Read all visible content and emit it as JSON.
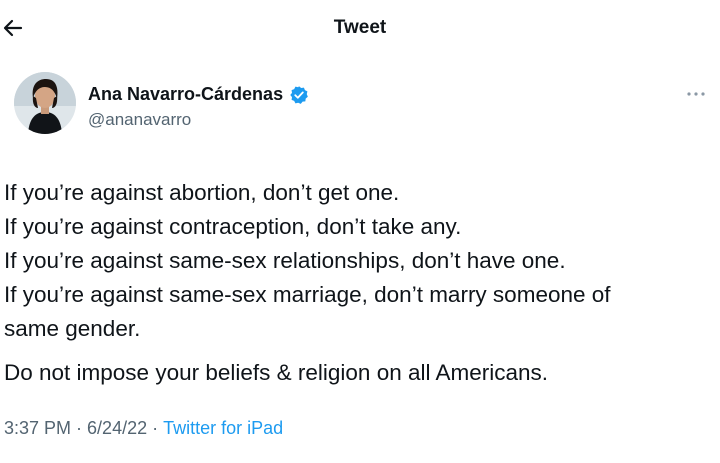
{
  "header": {
    "title": "Tweet"
  },
  "author": {
    "name": "Ana Navarro-Cárdenas",
    "handle": "@ananavarro",
    "verified": true
  },
  "tweet": {
    "lines": [
      "If you’re against abortion, don’t get one.",
      "If you’re against contraception, don’t take any.",
      "If you’re against same-sex relationships, don’t have one.",
      "If you’re against same-sex marriage, don’t marry someone of",
      "same gender."
    ],
    "closing": "Do not impose your beliefs & religion on all Americans."
  },
  "meta": {
    "time": "3:37 PM",
    "date": "6/24/22",
    "source": "Twitter for iPad",
    "separator": "·"
  },
  "colors": {
    "accent": "#1d9bf0",
    "text": "#0f1419",
    "secondary": "#536471"
  },
  "icons": {
    "back": "arrow-left-icon",
    "verified": "verified-badge-icon",
    "more": "more-options-icon"
  }
}
